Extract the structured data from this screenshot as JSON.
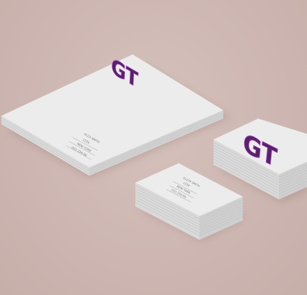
{
  "brand": {
    "logo_text": "GT",
    "logo_color": "#5a1f6e",
    "logo_outline": "#8a3fa0"
  },
  "letterhead": {
    "address_lines": [
      "0123 SMITH",
      "1234",
      "NEW YORK",
      "(01) 234-56"
    ]
  },
  "business_card_front": {
    "address_lines": [
      "01234 SMITH",
      "1234",
      "NEW YORK",
      "(01) 234-56"
    ]
  },
  "business_card_back": {
    "logo_text": "GT"
  },
  "colors": {
    "background": "#cfb8b3",
    "paper": "#ebebeb",
    "paper_shadow": "#b89f9a"
  }
}
